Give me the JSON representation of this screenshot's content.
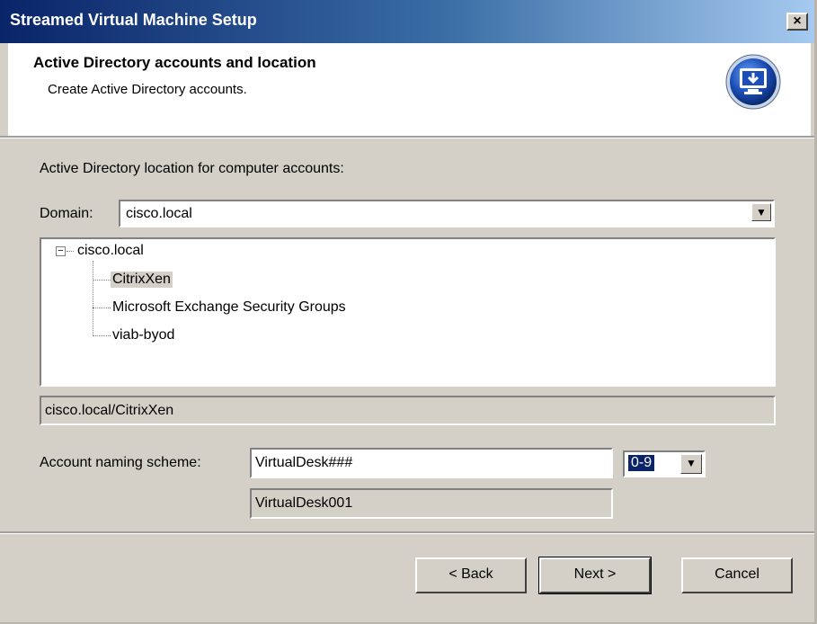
{
  "window": {
    "title": "Streamed Virtual Machine Setup",
    "close_glyph": "×"
  },
  "header": {
    "title": "Active Directory accounts and location",
    "subtitle": "Create Active Directory accounts.",
    "icon": "download-monitor-icon"
  },
  "location": {
    "label": "Active Directory location for computer accounts:",
    "domain_label": "Domain:",
    "domain_value": "cisco.local",
    "tree": {
      "root": "cisco.local",
      "root_expander": "−",
      "children": [
        "CitrixXen",
        "Microsoft Exchange Security Groups",
        "viab-byod"
      ],
      "selected_index": 0
    },
    "selected_path": "cisco.local/CitrixXen"
  },
  "naming": {
    "label": "Account naming scheme:",
    "value": "VirtualDesk###",
    "range_value": "0-9",
    "preview": "VirtualDesk001"
  },
  "buttons": {
    "back": "< Back",
    "next": "Next >",
    "cancel": "Cancel"
  },
  "colors": {
    "title_gradient_start": "#0a246a",
    "dialog_face": "#d4d0c8",
    "selection": "#0a246a"
  }
}
